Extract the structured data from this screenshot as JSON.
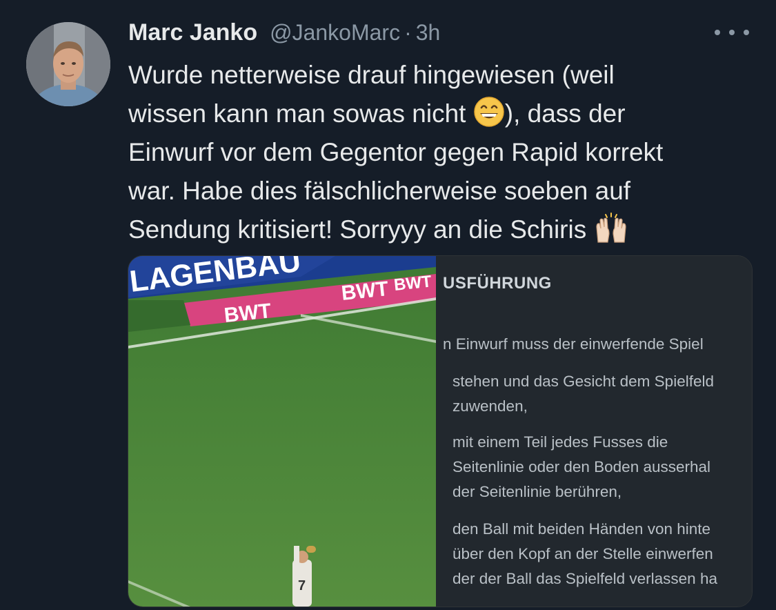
{
  "tweet": {
    "author_name": "Marc Janko",
    "handle": "@JankoMarc",
    "separator": "·",
    "time": "3h",
    "text_part1": "Wurde netterweise drauf hingewiesen (weil\nwissen kann man sowas nicht ",
    "emoji1": "grinning-face-emoji",
    "text_part2": "), dass der\nEinwurf vor dem Gegentor gegen Rapid korrekt\nwar. Habe dies fälschlicherweise soeben auf\nSendung kritisiert! Sorryyy an die Schiris ",
    "emoji2": "raising-hands-emoji"
  },
  "media": {
    "board_text_top": "LAGENBAU",
    "sponsor_text_1": "BWT",
    "sponsor_text_2": "BWT",
    "sponsor_text_3": "BWT",
    "player_number": "7",
    "doc_heading": "USFÜHRUNG",
    "doc_lines": [
      "n Einwurf muss der einwerfende Spiel",
      "stehen und das Gesicht dem Spielfeld\nzuwenden,",
      "mit einem Teil jedes Fusses die\nSeitenlinie oder den Boden ausserhal\nder Seitenlinie berühren,",
      "den Ball mit beiden Händen von hinte\nüber den Kopf an der Stelle einwerfen\nder der Ball das Spielfeld verlassen ha"
    ]
  },
  "colors": {
    "background": "#151d28",
    "text": "#e7e9ea",
    "muted": "#8b98a5",
    "pitch": "#4e8a3a",
    "board": "#d8447f"
  }
}
